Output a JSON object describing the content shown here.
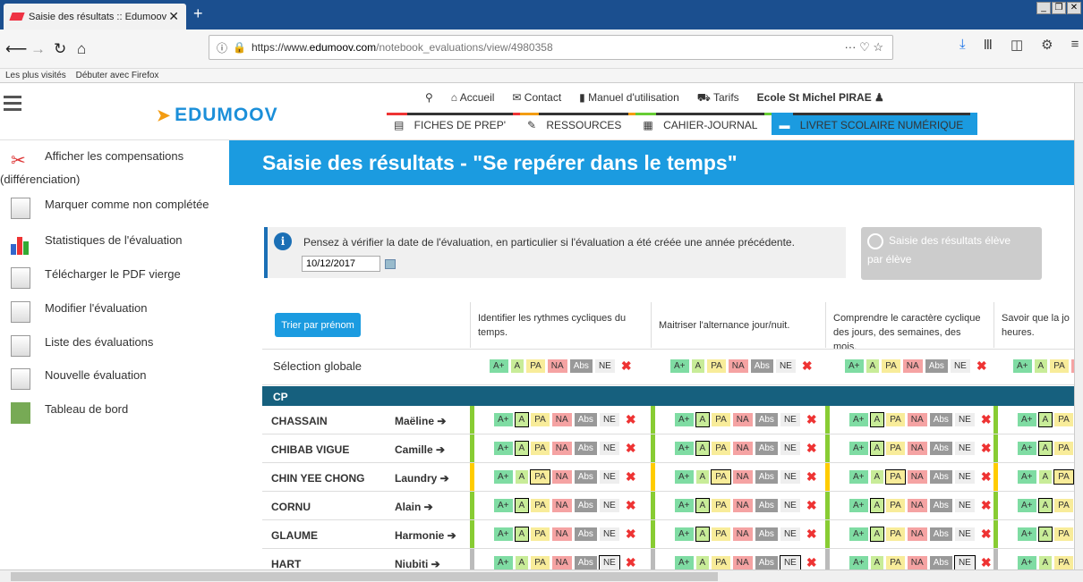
{
  "browser": {
    "tab_title": "Saisie des résultats :: Edumoov",
    "url_part1": "https://www.",
    "url_part2": "edumoov.com",
    "url_part3": "/notebook_evaluations/view/4980358",
    "url_right": "···  ♡  ☆",
    "bookmarks": [
      "Les plus visités",
      "Débuter avec Firefox"
    ]
  },
  "site": {
    "logo": "EDUMOOV",
    "nav": [
      "Accueil",
      "Contact",
      "Manuel d'utilisation",
      "Tarifs"
    ],
    "school": "Ecole St Michel PIRAE",
    "sections": [
      "FICHES DE PREP'",
      "RESSOURCES",
      "CAHIER-JOURNAL",
      "LIVRET SCOLAIRE NUMÉRIQUE"
    ]
  },
  "sidebar": [
    {
      "l1": "Afficher les compensations",
      "l2": "(différenciation)"
    },
    {
      "l1": "Marquer comme non complétée"
    },
    {
      "l1": "Statistiques de l'évaluation"
    },
    {
      "l1": "Télécharger le PDF vierge"
    },
    {
      "l1": "Modifier l'évaluation"
    },
    {
      "l1": "Liste des évaluations"
    },
    {
      "l1": "Nouvelle évaluation"
    },
    {
      "l1": "Tableau de bord"
    }
  ],
  "page": {
    "title": "Saisie des résultats - \"Se repérer dans le temps\"",
    "alert": "Pensez à vérifier la date de l'évaluation, en particulier si l'évaluation a été créée une année précédente.",
    "date": "10/12/2017",
    "eleve_btn_1": "Saisie des résultats élève",
    "eleve_btn_2": "par élève"
  },
  "grid": {
    "sort_btn": "Trier par prénom",
    "headers": [
      {
        "l1": "Identifier les rythmes cycliques du",
        "l2": "temps."
      },
      {
        "l1": "Maitriser l'alternance jour/nuit.",
        "l2": ""
      },
      {
        "l1": "Comprendre le caractère cyclique",
        "l2": "des jours, des semaines, des mois."
      },
      {
        "l1": "Savoir que la jo",
        "l2": "heures."
      }
    ],
    "global": "Sélection globale",
    "grade_labels": [
      "A+",
      "A",
      "PA",
      "NA",
      "Abs",
      "NE",
      "✖"
    ],
    "group": "CP",
    "students": [
      {
        "last": "CHASSAIN",
        "first": "Maëline ➔"
      },
      {
        "last": "CHIBAB VIGUE",
        "first": "Camille ➔"
      },
      {
        "last": "CHIN YEE CHONG",
        "first": "Laundry ➔"
      },
      {
        "last": "CORNU",
        "first": "Alain ➔"
      },
      {
        "last": "GLAUME",
        "first": "Harmonie ➔"
      },
      {
        "last": "HART",
        "first": "Niubiti ➔"
      }
    ],
    "selected_per_student": [
      "A",
      "A",
      "PA",
      "A",
      "A",
      "NE"
    ]
  },
  "colors": {
    "brand": "#1b9be0",
    "group_bar": "#16607e",
    "ok": "#88cc33",
    "warn": "#ffcc00"
  }
}
